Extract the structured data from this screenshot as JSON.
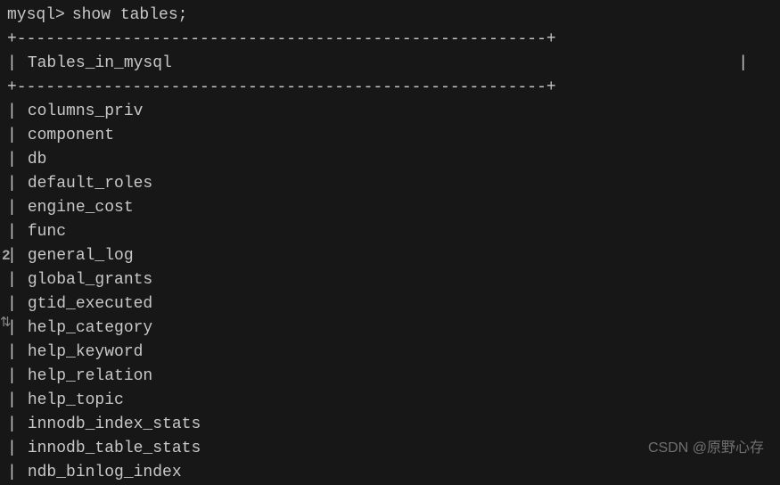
{
  "terminal": {
    "prompt": "mysql>",
    "command": "show tables;",
    "border_top": "+-------------------------------------------------------+",
    "header": {
      "pipe_left": "|",
      "text": "Tables_in_mysql",
      "pipe_right": "|"
    },
    "border_mid": "+-------------------------------------------------------+",
    "rows": [
      "columns_priv",
      "component",
      "db",
      "default_roles",
      "engine_cost",
      "func",
      "general_log",
      "global_grants",
      "gtid_executed",
      "help_category",
      "help_keyword",
      "help_relation",
      "help_topic",
      "innodb_index_stats",
      "innodb_table_stats",
      "ndb_binlog_index"
    ],
    "row_pipe": "|"
  },
  "gutter": {
    "num": "2",
    "icon": "⇅"
  },
  "watermark": "CSDN @原野心存"
}
